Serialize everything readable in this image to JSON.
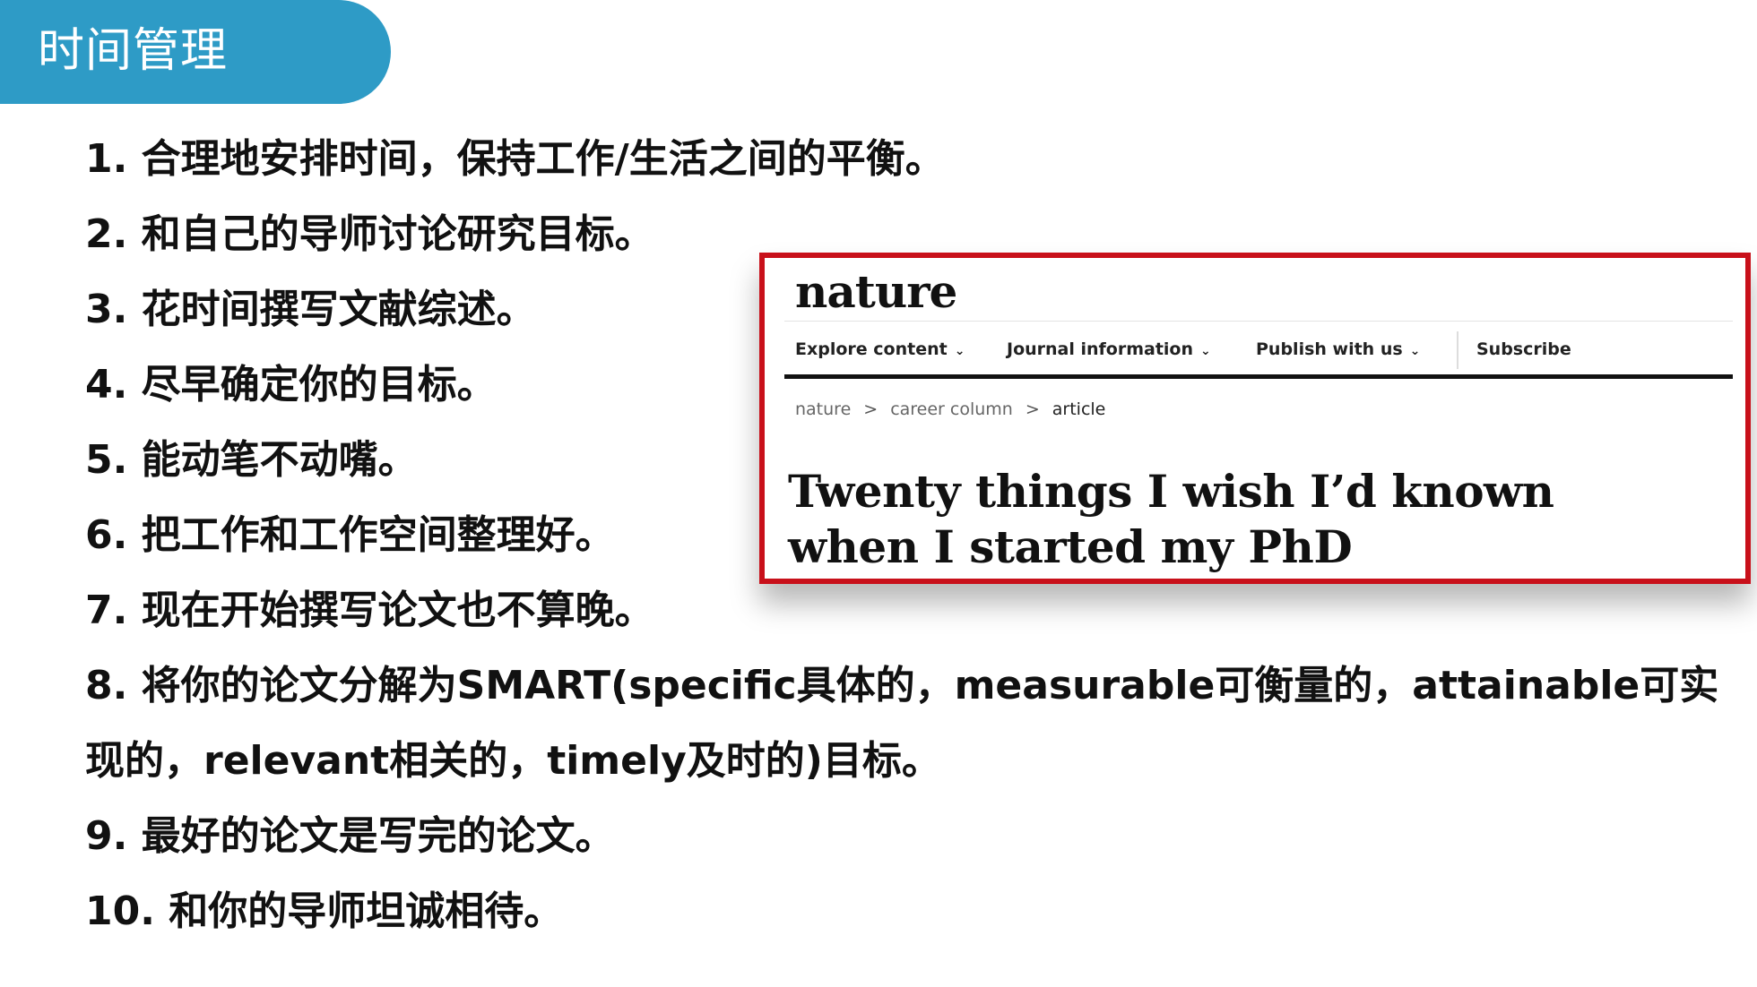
{
  "header": {
    "title": "时间管理"
  },
  "items": [
    "1. 合理地安排时间，保持工作/生活之间的平衡。",
    "2. 和自己的导师讨论研究目标。",
    "3. 花时间撰写文献综述。",
    "4. 尽早确定你的目标。",
    "5. 能动笔不动嘴。",
    "6. 把工作和工作空间整理好。",
    "7. 现在开始撰写论文也不算晚。",
    "8. 将你的论文分解为SMART(specific具体的，measurable可衡量的，attainable可实",
    "现的，relevant相关的，timely及时的)目标。",
    "9. 最好的论文是写完的论文。",
    "10. 和你的导师坦诚相待。"
  ],
  "article_card": {
    "logo": "nature",
    "nav": [
      {
        "label": "Explore content",
        "chevron": "⌄"
      },
      {
        "label": "Journal information",
        "chevron": "⌄"
      },
      {
        "label": "Publish with us",
        "chevron": "⌄"
      },
      {
        "label": "Subscribe"
      }
    ],
    "breadcrumb": [
      "nature",
      "career column",
      "article"
    ],
    "breadcrumb_separator": ">",
    "headline_line1": "Twenty things I wish I’d known",
    "headline_line2": "when I started my PhD",
    "border_color": "#c8101a"
  },
  "colors": {
    "title_bar": "#2e9bc6",
    "text": "#111111"
  }
}
